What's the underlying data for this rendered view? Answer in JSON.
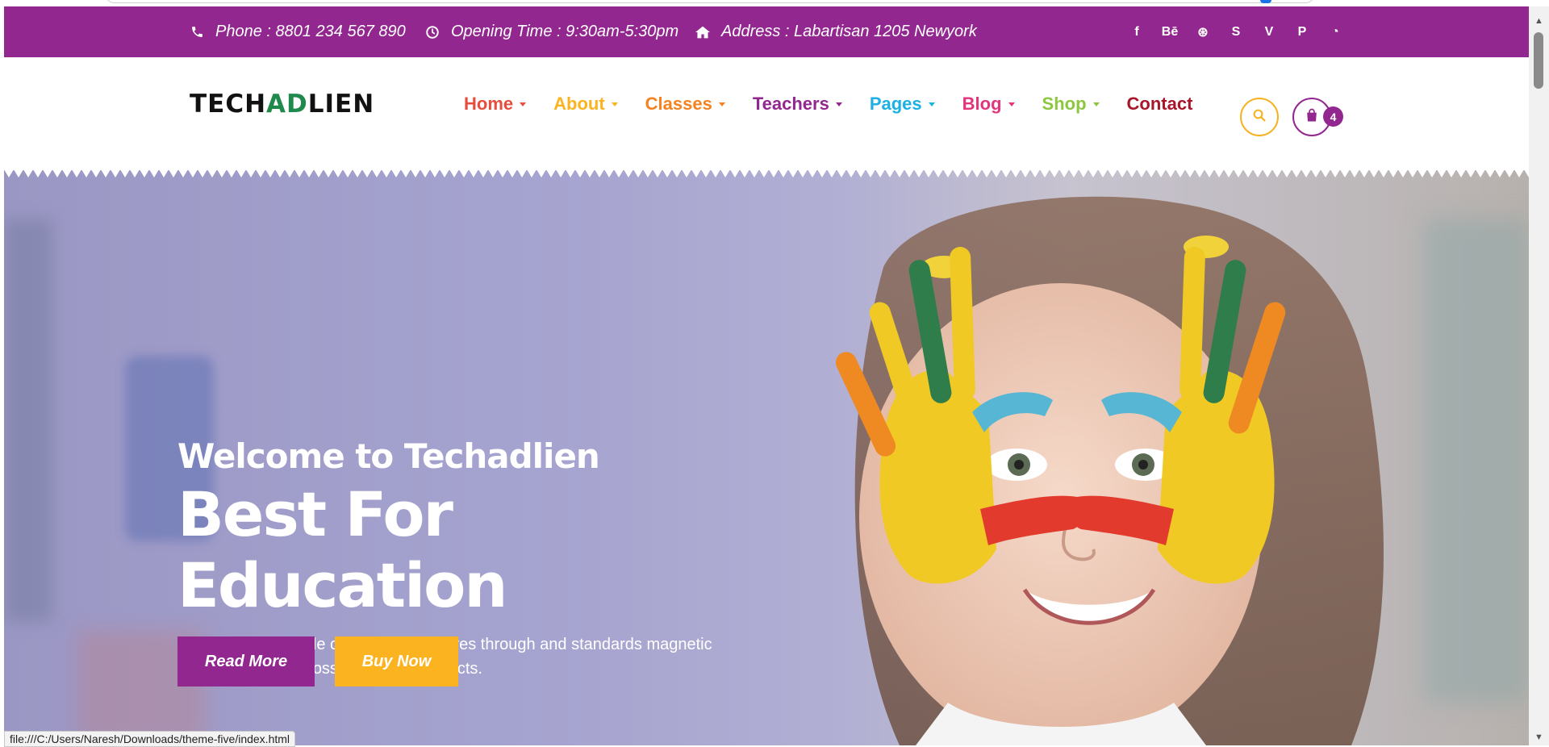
{
  "colors": {
    "brand_purple": "#92278f",
    "brand_yellow": "#fbb31f",
    "search_ring": "#f5b324"
  },
  "topbar": {
    "phone": "Phone : 8801 234 567 890",
    "opening": "Opening Time : 9:30am-5:30pm",
    "address": "Address : Labartisan 1205 Newyork",
    "icons": [
      "phone-icon",
      "clock-icon",
      "home-icon"
    ],
    "socials": [
      "facebook-icon",
      "behance-icon",
      "dribbble-icon",
      "skype-icon",
      "vimeo-icon",
      "pinterest-icon",
      "rss-icon"
    ],
    "social_glyphs": [
      "f",
      "Bē",
      "⊛",
      "S",
      "V",
      "P",
      "◔"
    ]
  },
  "header": {
    "logo": {
      "left": "TECH",
      "mid": "AD",
      "right": "LIEN"
    },
    "nav": [
      {
        "label": "Home",
        "color": "#e74c3c",
        "dropdown": true
      },
      {
        "label": "About",
        "color": "#fbb31f",
        "dropdown": true
      },
      {
        "label": "Classes",
        "color": "#f58220",
        "dropdown": true
      },
      {
        "label": "Teachers",
        "color": "#92278f",
        "dropdown": true
      },
      {
        "label": "Pages",
        "color": "#1cb0e3",
        "dropdown": true
      },
      {
        "label": "Blog",
        "color": "#e2357e",
        "dropdown": true
      },
      {
        "label": "Shop",
        "color": "#8dc63f",
        "dropdown": true
      },
      {
        "label": "Contact",
        "color": "#a8162a",
        "dropdown": false
      }
    ],
    "cart_count": "4"
  },
  "hero": {
    "welcome": "Welcome to Techadlien",
    "headline": "Best For Education",
    "description": "Monotonely principle centered ahitectures through and standards magnetic metrics whereas cross functional products.",
    "read_more": "Read More",
    "buy_now": "Buy Now"
  },
  "status_url": "file:///C:/Users/Naresh/Downloads/theme-five/index.html"
}
